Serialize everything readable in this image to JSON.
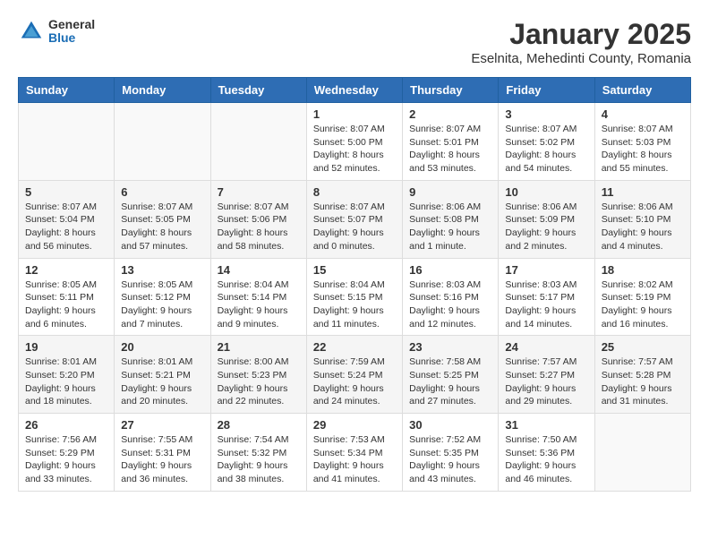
{
  "header": {
    "logo": {
      "general": "General",
      "blue": "Blue"
    },
    "title": "January 2025",
    "subtitle": "Eselnita, Mehedinti County, Romania"
  },
  "weekdays": [
    "Sunday",
    "Monday",
    "Tuesday",
    "Wednesday",
    "Thursday",
    "Friday",
    "Saturday"
  ],
  "weeks": [
    [
      {
        "day": "",
        "info": ""
      },
      {
        "day": "",
        "info": ""
      },
      {
        "day": "",
        "info": ""
      },
      {
        "day": "1",
        "info": "Sunrise: 8:07 AM\nSunset: 5:00 PM\nDaylight: 8 hours and 52 minutes."
      },
      {
        "day": "2",
        "info": "Sunrise: 8:07 AM\nSunset: 5:01 PM\nDaylight: 8 hours and 53 minutes."
      },
      {
        "day": "3",
        "info": "Sunrise: 8:07 AM\nSunset: 5:02 PM\nDaylight: 8 hours and 54 minutes."
      },
      {
        "day": "4",
        "info": "Sunrise: 8:07 AM\nSunset: 5:03 PM\nDaylight: 8 hours and 55 minutes."
      }
    ],
    [
      {
        "day": "5",
        "info": "Sunrise: 8:07 AM\nSunset: 5:04 PM\nDaylight: 8 hours and 56 minutes."
      },
      {
        "day": "6",
        "info": "Sunrise: 8:07 AM\nSunset: 5:05 PM\nDaylight: 8 hours and 57 minutes."
      },
      {
        "day": "7",
        "info": "Sunrise: 8:07 AM\nSunset: 5:06 PM\nDaylight: 8 hours and 58 minutes."
      },
      {
        "day": "8",
        "info": "Sunrise: 8:07 AM\nSunset: 5:07 PM\nDaylight: 9 hours and 0 minutes."
      },
      {
        "day": "9",
        "info": "Sunrise: 8:06 AM\nSunset: 5:08 PM\nDaylight: 9 hours and 1 minute."
      },
      {
        "day": "10",
        "info": "Sunrise: 8:06 AM\nSunset: 5:09 PM\nDaylight: 9 hours and 2 minutes."
      },
      {
        "day": "11",
        "info": "Sunrise: 8:06 AM\nSunset: 5:10 PM\nDaylight: 9 hours and 4 minutes."
      }
    ],
    [
      {
        "day": "12",
        "info": "Sunrise: 8:05 AM\nSunset: 5:11 PM\nDaylight: 9 hours and 6 minutes."
      },
      {
        "day": "13",
        "info": "Sunrise: 8:05 AM\nSunset: 5:12 PM\nDaylight: 9 hours and 7 minutes."
      },
      {
        "day": "14",
        "info": "Sunrise: 8:04 AM\nSunset: 5:14 PM\nDaylight: 9 hours and 9 minutes."
      },
      {
        "day": "15",
        "info": "Sunrise: 8:04 AM\nSunset: 5:15 PM\nDaylight: 9 hours and 11 minutes."
      },
      {
        "day": "16",
        "info": "Sunrise: 8:03 AM\nSunset: 5:16 PM\nDaylight: 9 hours and 12 minutes."
      },
      {
        "day": "17",
        "info": "Sunrise: 8:03 AM\nSunset: 5:17 PM\nDaylight: 9 hours and 14 minutes."
      },
      {
        "day": "18",
        "info": "Sunrise: 8:02 AM\nSunset: 5:19 PM\nDaylight: 9 hours and 16 minutes."
      }
    ],
    [
      {
        "day": "19",
        "info": "Sunrise: 8:01 AM\nSunset: 5:20 PM\nDaylight: 9 hours and 18 minutes."
      },
      {
        "day": "20",
        "info": "Sunrise: 8:01 AM\nSunset: 5:21 PM\nDaylight: 9 hours and 20 minutes."
      },
      {
        "day": "21",
        "info": "Sunrise: 8:00 AM\nSunset: 5:23 PM\nDaylight: 9 hours and 22 minutes."
      },
      {
        "day": "22",
        "info": "Sunrise: 7:59 AM\nSunset: 5:24 PM\nDaylight: 9 hours and 24 minutes."
      },
      {
        "day": "23",
        "info": "Sunrise: 7:58 AM\nSunset: 5:25 PM\nDaylight: 9 hours and 27 minutes."
      },
      {
        "day": "24",
        "info": "Sunrise: 7:57 AM\nSunset: 5:27 PM\nDaylight: 9 hours and 29 minutes."
      },
      {
        "day": "25",
        "info": "Sunrise: 7:57 AM\nSunset: 5:28 PM\nDaylight: 9 hours and 31 minutes."
      }
    ],
    [
      {
        "day": "26",
        "info": "Sunrise: 7:56 AM\nSunset: 5:29 PM\nDaylight: 9 hours and 33 minutes."
      },
      {
        "day": "27",
        "info": "Sunrise: 7:55 AM\nSunset: 5:31 PM\nDaylight: 9 hours and 36 minutes."
      },
      {
        "day": "28",
        "info": "Sunrise: 7:54 AM\nSunset: 5:32 PM\nDaylight: 9 hours and 38 minutes."
      },
      {
        "day": "29",
        "info": "Sunrise: 7:53 AM\nSunset: 5:34 PM\nDaylight: 9 hours and 41 minutes."
      },
      {
        "day": "30",
        "info": "Sunrise: 7:52 AM\nSunset: 5:35 PM\nDaylight: 9 hours and 43 minutes."
      },
      {
        "day": "31",
        "info": "Sunrise: 7:50 AM\nSunset: 5:36 PM\nDaylight: 9 hours and 46 minutes."
      },
      {
        "day": "",
        "info": ""
      }
    ]
  ]
}
